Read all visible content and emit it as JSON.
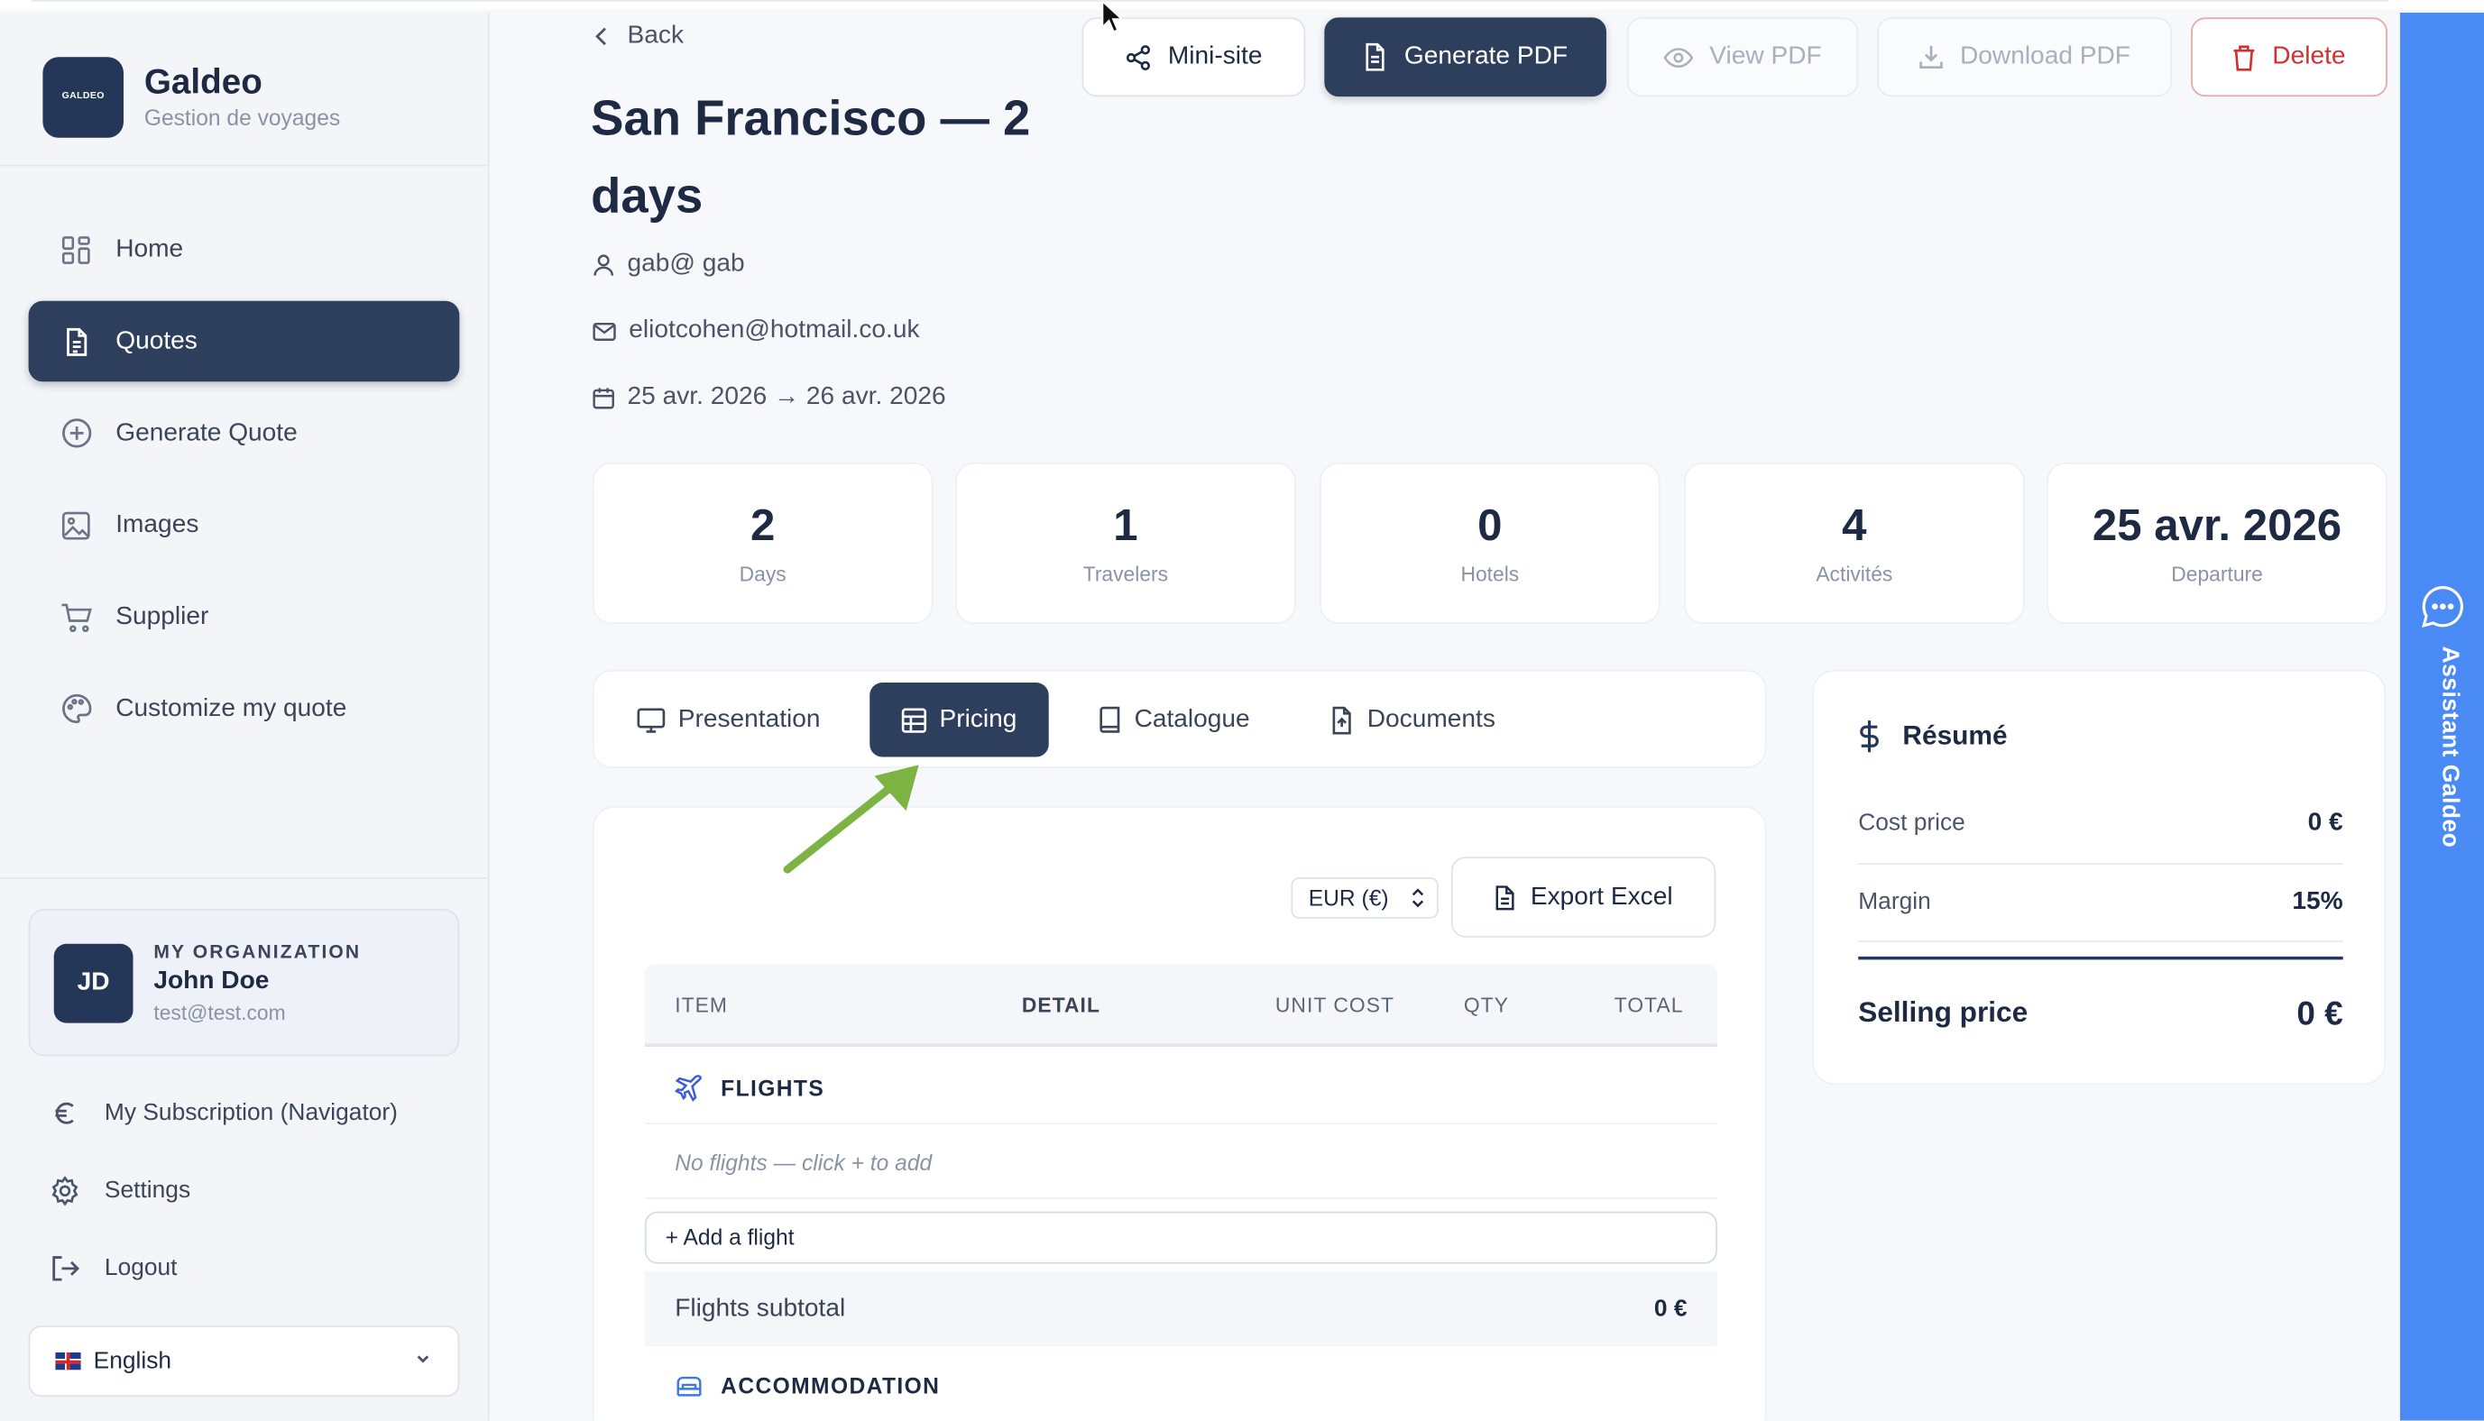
{
  "brand": {
    "logo_text": "GALDEO",
    "name": "Galdeo",
    "subtitle": "Gestion de voyages"
  },
  "nav": {
    "items": [
      {
        "label": "Home",
        "icon": "grid-icon",
        "active": false
      },
      {
        "label": "Quotes",
        "icon": "document-icon",
        "active": true
      },
      {
        "label": "Generate Quote",
        "icon": "plus-circle-icon",
        "active": false
      },
      {
        "label": "Images",
        "icon": "image-icon",
        "active": false
      },
      {
        "label": "Supplier",
        "icon": "cart-icon",
        "active": false
      },
      {
        "label": "Customize my quote",
        "icon": "palette-icon",
        "active": false
      }
    ]
  },
  "org": {
    "label": "MY ORGANIZATION",
    "initials": "JD",
    "name": "John Doe",
    "email": "test@test.com"
  },
  "sub_nav": {
    "subscription": "My Subscription (Navigator)",
    "settings": "Settings",
    "logout": "Logout"
  },
  "language": {
    "selected": "English"
  },
  "header": {
    "back": "Back",
    "title": "San Francisco — 2 days",
    "client": "gab@ gab",
    "email": "eliotcohen@hotmail.co.uk",
    "dates": "25 avr. 2026 → 26 avr. 2026"
  },
  "toolbar": {
    "minisite": "Mini-site",
    "generate_pdf": "Generate PDF",
    "view_pdf": "View PDF",
    "download_pdf": "Download PDF",
    "delete": "Delete"
  },
  "stats": [
    {
      "value": "2",
      "label": "Days"
    },
    {
      "value": "1",
      "label": "Travelers"
    },
    {
      "value": "0",
      "label": "Hotels"
    },
    {
      "value": "4",
      "label": "Activités"
    },
    {
      "value": "25 avr. 2026",
      "label": "Departure"
    }
  ],
  "tabs": {
    "presentation": "Presentation",
    "pricing": "Pricing",
    "catalogue": "Catalogue",
    "documents": "Documents",
    "active": "pricing"
  },
  "pricing": {
    "currency": "EUR (€)",
    "export": "Export Excel",
    "columns": {
      "item": "ITEM",
      "detail": "DETAIL",
      "unit_cost": "UNIT COST",
      "qty": "QTY",
      "total": "TOTAL"
    },
    "flights": {
      "title": "FLIGHTS",
      "empty": "No flights — click + to add",
      "add": "+ Add a flight",
      "subtotal_label": "Flights subtotal",
      "subtotal_value": "0 €"
    },
    "accommodation": {
      "title": "ACCOMMODATION"
    }
  },
  "summary": {
    "title": "Résumé",
    "cost_label": "Cost price",
    "cost_value": "0 €",
    "margin_label": "Margin",
    "margin_value": "15%",
    "selling_label": "Selling price",
    "selling_value": "0 €"
  },
  "assistant": {
    "label": "Assistant Galdeo"
  },
  "colors": {
    "primary": "#2e3f5e",
    "accent": "#4a8af4",
    "danger": "#d0302f",
    "annotation_arrow": "#7cb342"
  }
}
